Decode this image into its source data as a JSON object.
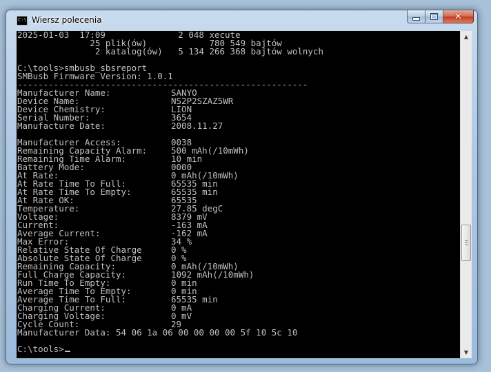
{
  "window": {
    "title": "Wiersz polecenia",
    "icon": "cmd-icon"
  },
  "buttons": {
    "minimize": "minimize-icon",
    "maximize": "maximize-icon",
    "close": "close-icon",
    "close_glyph": "✕"
  },
  "console": {
    "header": [
      "2025-01-03  17:09              2 048 xecute",
      "              25 plik(ów)            780 549 bajtów",
      "               2 katalog(ów)   5 134 266 368 bajtów wolnych",
      "",
      "C:\\tools>smbusb_sbsreport",
      "SMBusb Firmware Version: 1.0.1",
      "--------------------------------------------------------"
    ],
    "report": [
      [
        "Manufacturer Name:",
        "SANYO"
      ],
      [
        "Device Name:",
        "NS2P2SZAZ5WR"
      ],
      [
        "Device Chemistry:",
        "LION"
      ],
      [
        "Serial Number:",
        "3654"
      ],
      [
        "Manufacture Date:",
        "2008.11.27"
      ],
      [
        "",
        ""
      ],
      [
        "Manufacturer Access:",
        "0038"
      ],
      [
        "Remaining Capacity Alarm:",
        "500 mAh(/10mWh)"
      ],
      [
        "Remaining Time Alarm:",
        "10 min"
      ],
      [
        "Battery Mode:",
        "0000"
      ],
      [
        "At Rate:",
        "0 mAh(/10mWh)"
      ],
      [
        "At Rate Time To Full:",
        "65535 min"
      ],
      [
        "At Rate Time To Empty:",
        "65535 min"
      ],
      [
        "At Rate OK:",
        "65535"
      ],
      [
        "Temperature:",
        "27.85 degC"
      ],
      [
        "Voltage:",
        "8379 mV"
      ],
      [
        "Current:",
        "-163 mA"
      ],
      [
        "Average Current:",
        "-162 mA"
      ],
      [
        "Max Error:",
        "34 %"
      ],
      [
        "Relative State Of Charge",
        "0 %"
      ],
      [
        "Absolute State Of Charge",
        "0 %"
      ],
      [
        "Remaining Capacity:",
        "0 mAh(/10mWh)"
      ],
      [
        "Full Charge Capacity:",
        "1092 mAh(/10mWh)"
      ],
      [
        "Run Time To Empty:",
        "0 min"
      ],
      [
        "Average Time To Empty:",
        "0 min"
      ],
      [
        "Average Time To Full:",
        "65535 min"
      ],
      [
        "Charging Current:",
        "0 mA"
      ],
      [
        "Charging Voltage:",
        "0 mV"
      ],
      [
        "Cycle Count:",
        "29"
      ]
    ],
    "manufacturer_data": "Manufacturer Data: 54 06 1a 06 00 00 00 00 5f 10 5c 10",
    "prompt": "C:\\tools>"
  },
  "scrollbar": {
    "up_icon": "▲",
    "down_icon": "▼",
    "position": 0.68
  }
}
